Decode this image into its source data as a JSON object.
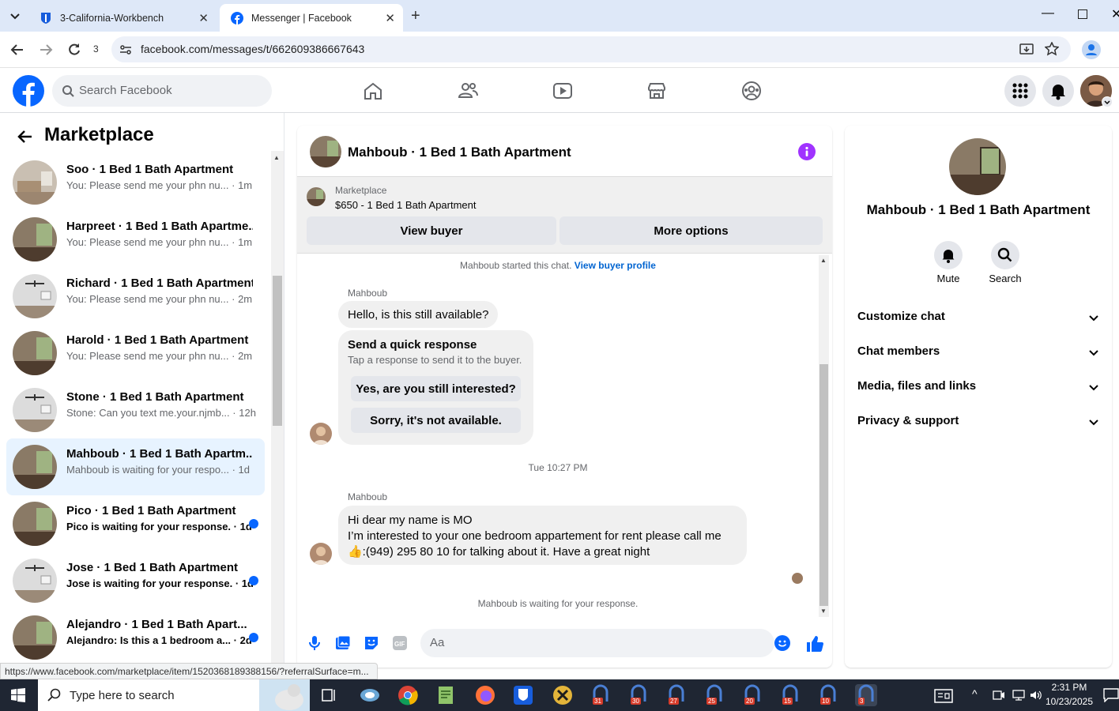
{
  "browser": {
    "tabs": [
      {
        "title": "3-California-Workbench"
      },
      {
        "title": "Messenger | Facebook"
      }
    ],
    "reload_count": "3",
    "url": "facebook.com/messages/t/662609386667643"
  },
  "fb": {
    "search_placeholder": "Search Facebook"
  },
  "left": {
    "title": "Marketplace",
    "conversations": [
      {
        "name": "Soo · 1 Bed 1 Bath Apartment",
        "preview": "You: Please send me your phn nu...",
        "time": "· 1m",
        "unread": false
      },
      {
        "name": "Harpreet · 1 Bed 1 Bath Apartme...",
        "preview": "You: Please send me your phn nu...",
        "time": "· 1m",
        "unread": false
      },
      {
        "name": "Richard · 1 Bed 1 Bath Apartment",
        "preview": "You: Please send me your phn nu...",
        "time": "· 2m",
        "unread": false
      },
      {
        "name": "Harold · 1 Bed 1 Bath Apartment",
        "preview": "You: Please send me your phn nu...",
        "time": "· 2m",
        "unread": false
      },
      {
        "name": "Stone · 1 Bed 1 Bath Apartment",
        "preview": "Stone: Can you text me.your.njmb...",
        "time": "· 12h",
        "unread": false
      },
      {
        "name": "Mahboub · 1 Bed 1 Bath Apartm...",
        "preview": "Mahboub is waiting for your respo...",
        "time": "· 1d",
        "unread": false
      },
      {
        "name": "Pico · 1 Bed 1 Bath Apartment",
        "preview": "Pico is waiting for your response.",
        "time": "· 1d",
        "unread": true
      },
      {
        "name": "Jose · 1 Bed 1 Bath Apartment",
        "preview": "Jose is waiting for your response.",
        "time": "· 1d",
        "unread": true
      },
      {
        "name": "Alejandro · 1 Bed 1 Bath Apart...",
        "preview": "Alejandro: Is this a 1 bedroom a...",
        "time": "· 2d",
        "unread": true
      }
    ]
  },
  "chat": {
    "header_title": "Mahboub · 1 Bed 1 Bath Apartment",
    "listing_source": "Marketplace",
    "listing_title": "$650 - 1 Bed 1 Bath Apartment",
    "view_buyer": "View buyer",
    "more_options": "More options",
    "started_text": "Mahboub started this chat.",
    "view_profile": "View buyer profile",
    "sender1": "Mahboub",
    "msg1": "Hello, is this still available?",
    "quick_title": "Send a quick response",
    "quick_sub": "Tap a response to send it to the buyer.",
    "quick1": "Yes, are you still interested?",
    "quick2": "Sorry, it's not available.",
    "timestamp": "Tue 10:27 PM",
    "sender2": "Mahboub",
    "msg2_lines": [
      "Hi dear my name is MO",
      "I’m interested to your one bedroom appartement for rent please call me",
      "👍:(949) 295 80 10 for talking about it. Have a great night"
    ],
    "waiting": "Mahboub is waiting for your response.",
    "composer_placeholder": "Aa"
  },
  "right": {
    "title": "Mahboub · 1 Bed 1 Bath Apartment",
    "mute": "Mute",
    "search": "Search",
    "sections": [
      "Customize chat",
      "Chat members",
      "Media, files and links",
      "Privacy & support"
    ]
  },
  "status_url": "https://www.facebook.com/marketplace/item/1520368189388156/?referralSurface=m...",
  "taskbar": {
    "search_placeholder": "Type here to search",
    "time": "2:31 PM",
    "date": "10/23/2025",
    "badges": [
      "31",
      "30",
      "27",
      "25",
      "20",
      "15",
      "10",
      "3"
    ]
  },
  "colors": {
    "fb_blue": "#0866ff",
    "messenger_purple": "#a033ff",
    "selected_bg": "#e7f3ff"
  }
}
